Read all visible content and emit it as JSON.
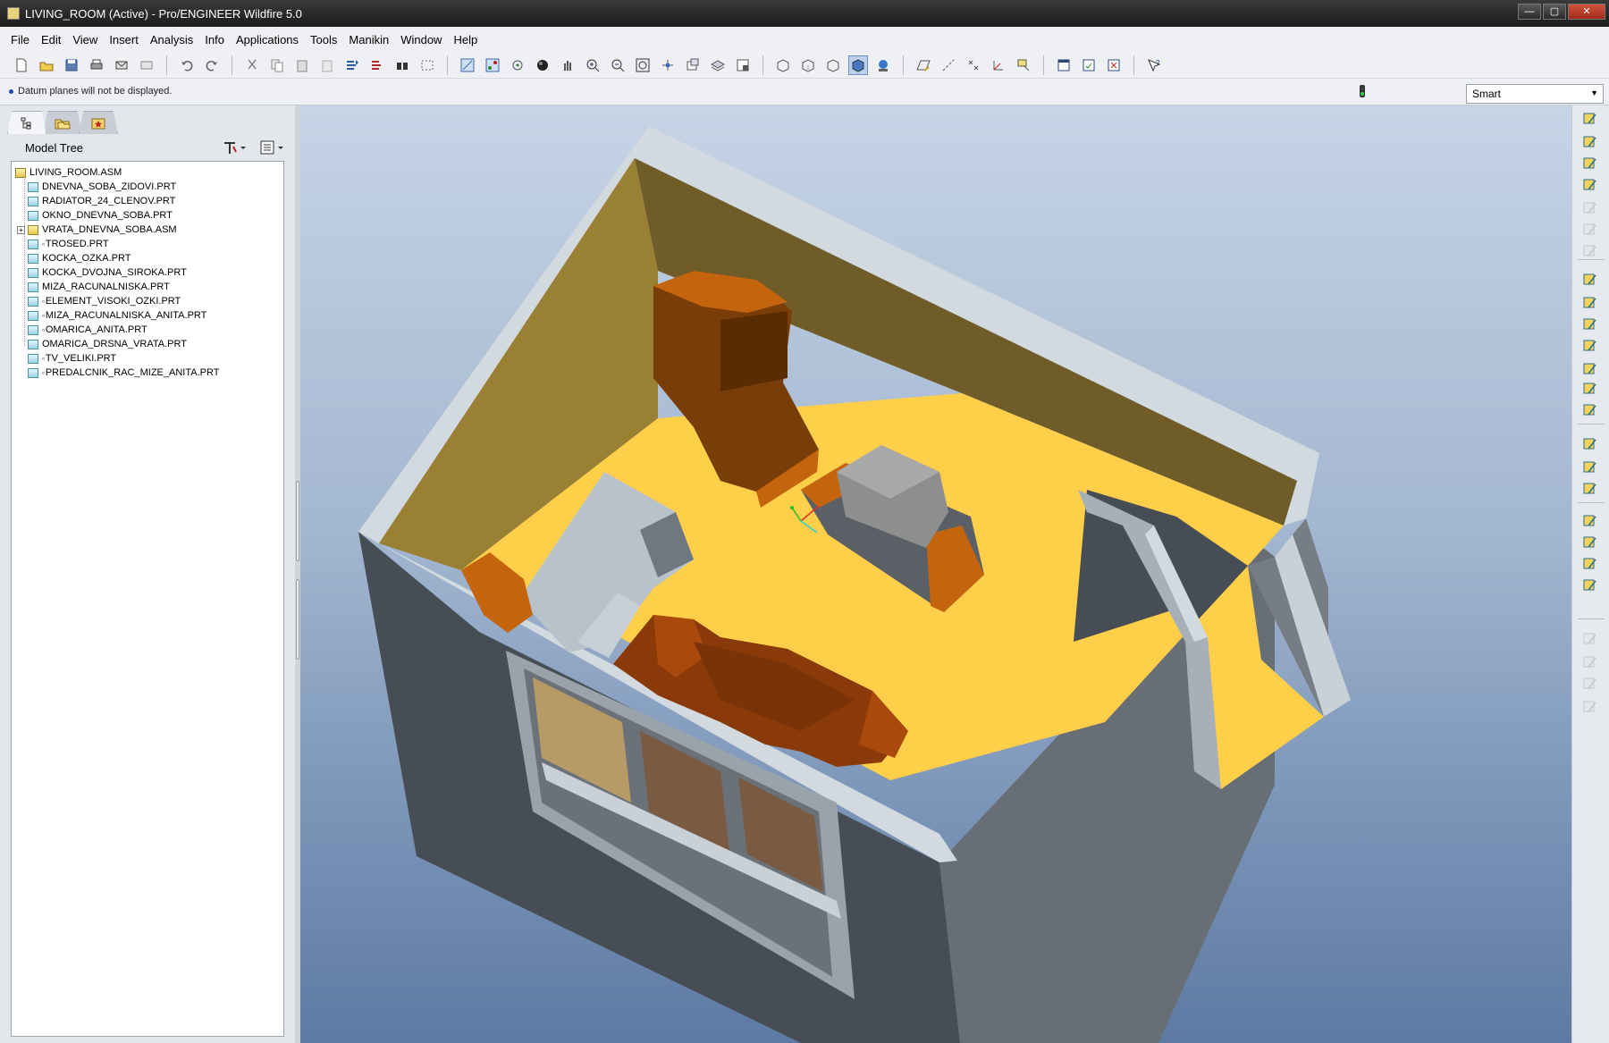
{
  "window": {
    "title": "LIVING_ROOM (Active) - Pro/ENGINEER Wildfire 5.0",
    "minimize": "—",
    "maximize": "▢",
    "close": "✕"
  },
  "menubar": {
    "items": [
      "File",
      "Edit",
      "View",
      "Insert",
      "Analysis",
      "Info",
      "Applications",
      "Tools",
      "Manikin",
      "Window",
      "Help"
    ]
  },
  "toolbar": {
    "icons": [
      "new-file-icon",
      "open-file-icon",
      "save-icon",
      "print-icon",
      "send-mail-icon",
      "mail-recipient-icon",
      "undo-icon",
      "redo-icon",
      "cut-icon",
      "copy-icon",
      "paste-icon",
      "paste-special-icon",
      "regenerate-icon",
      "regenerate-manager-icon",
      "find-icon",
      "select-box-icon",
      "datum-planes-icon",
      "datum-axes-icon",
      "point-icon",
      "shading-sphere-icon",
      "pan-icon",
      "zoom-in-icon",
      "zoom-out-icon",
      "refit-icon",
      "reorient-icon",
      "saved-views-icon",
      "layers-icon",
      "view-manager-icon",
      "wireframe-icon",
      "hidden-line-icon",
      "no-hidden-icon",
      "shading-icon",
      "enhanced-realism-icon",
      "datum-plane-display-icon",
      "datum-axis-display-icon",
      "point-display-icon",
      "csys-display-icon",
      "annotation-display-icon",
      "window-activate-icon",
      "window-close-icon",
      "window-exit-icon",
      "context-help-icon"
    ]
  },
  "status": {
    "message": "Datum planes will not be displayed."
  },
  "filter": {
    "selected": "Smart"
  },
  "model_tree": {
    "title": "Model Tree",
    "items": [
      {
        "label": "LIVING_ROOM.ASM",
        "type": "asm",
        "level": 0
      },
      {
        "label": "DNEVNA_SOBA_ZIDOVI.PRT",
        "type": "prt",
        "level": 1
      },
      {
        "label": "RADIATOR_24_CLENOV.PRT",
        "type": "prt",
        "level": 1
      },
      {
        "label": "OKNO_DNEVNA_SOBA.PRT",
        "type": "prt",
        "level": 1
      },
      {
        "label": "VRATA_DNEVNA_SOBA.ASM",
        "type": "asm",
        "level": 1,
        "expandable": true
      },
      {
        "label": "TROSED.PRT",
        "type": "prt",
        "level": 1,
        "flag": true
      },
      {
        "label": "KOCKA_OZKA.PRT",
        "type": "prt",
        "level": 1
      },
      {
        "label": "KOCKA_DVOJNA_SIROKA.PRT",
        "type": "prt",
        "level": 1
      },
      {
        "label": "MIZA_RACUNALNISKA.PRT",
        "type": "prt",
        "level": 1
      },
      {
        "label": "ELEMENT_VISOKI_OZKI.PRT",
        "type": "prt",
        "level": 1,
        "flag": true
      },
      {
        "label": "MIZA_RACUNALNISKA_ANITA.PRT",
        "type": "prt",
        "level": 1,
        "flag": true
      },
      {
        "label": "OMARICA_ANITA.PRT",
        "type": "prt",
        "level": 1,
        "flag": true
      },
      {
        "label": "OMARICA_DRSNA_VRATA.PRT",
        "type": "prt",
        "level": 1
      },
      {
        "label": "TV_VELIKI.PRT",
        "type": "prt",
        "level": 1,
        "flag": true
      },
      {
        "label": "PREDALCNIK_RAC_MIZE_ANITA.PRT",
        "type": "prt",
        "level": 1,
        "flag": true
      }
    ]
  },
  "right_toolbar": {
    "icons": [
      "component-assemble-icon",
      "component-create-icon",
      "package-icon",
      "manikin-icon",
      "disabled-1-icon",
      "disabled-2-icon",
      "disabled-3-icon",
      "sketch-icon",
      "datum-plane-icon",
      "datum-axis-icon",
      "datum-curve-icon",
      "datum-point-icon",
      "offset-point-icon",
      "csys-icon",
      "annotation-icon",
      "analysis-icon",
      "cosmetic-icon",
      "extrude-icon",
      "revolve-icon",
      "sweep-icon",
      "blend-icon",
      "disabled-4-icon",
      "disabled-5-icon",
      "disabled-6-icon",
      "disabled-7-icon"
    ]
  }
}
